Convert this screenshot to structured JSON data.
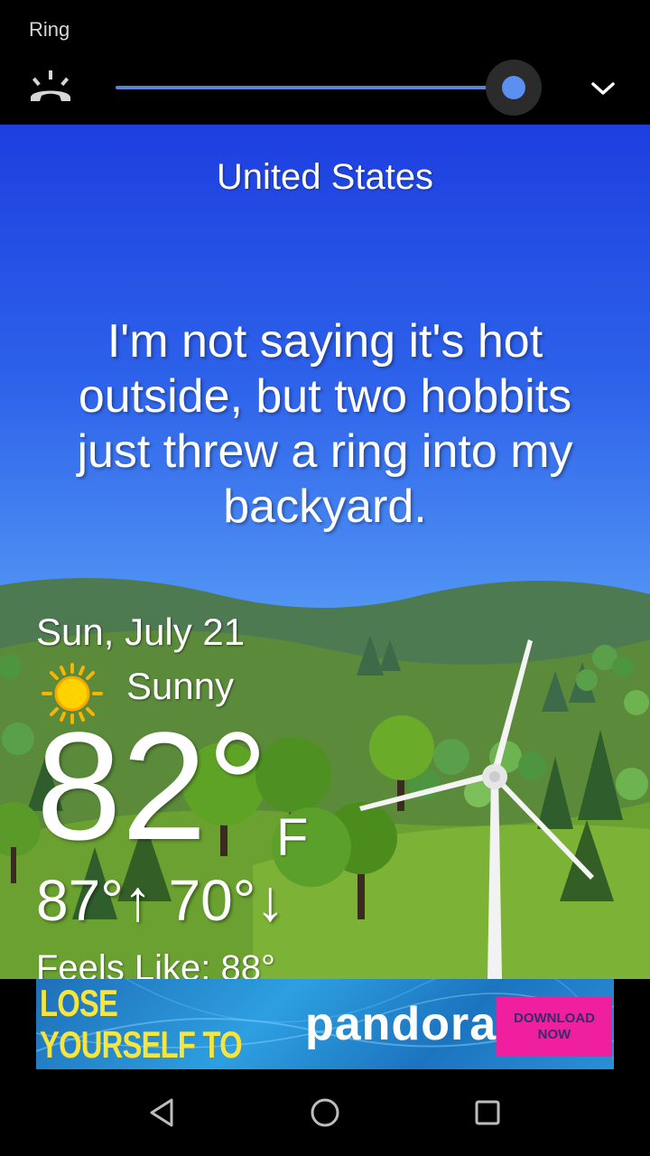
{
  "volume_panel": {
    "label": "Ring",
    "level": 0.95,
    "icons": {
      "ringer": "ringer-icon",
      "expand": "chevron-down-icon"
    }
  },
  "weather": {
    "location_line": "United States",
    "quote": "I'm not saying it's hot outside, but two hobbits just threw a ring into my backyard.",
    "date": "Sun, July 21",
    "condition": "Sunny",
    "condition_icon": "sun-icon",
    "temperature": "82°",
    "unit": "F",
    "high_low": "87°↑ 70°↓",
    "feels_like": "Feels Like: 88°"
  },
  "ad": {
    "headline": "LOSE YOURSELF TO THE MUSIC",
    "brand": "pandora",
    "cta": "DOWNLOAD NOW"
  },
  "navbar": {
    "icons": [
      "back-icon",
      "home-icon",
      "recents-icon"
    ]
  },
  "colors": {
    "accent": "#5b8ff0",
    "sky_top": "#1d3fe0",
    "grass": "#5f9a2a",
    "ad_cta": "#f01fa0"
  }
}
